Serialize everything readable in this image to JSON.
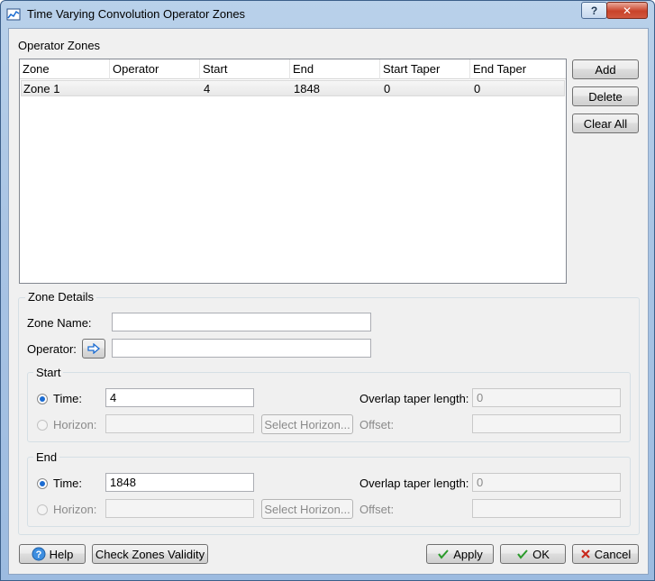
{
  "window": {
    "title": "Time Varying Convolution Operator Zones",
    "help_glyph": "?",
    "close_glyph": "✕"
  },
  "zones": {
    "label": "Operator Zones",
    "columns": [
      "Zone",
      "Operator",
      "Start",
      "End",
      "Start Taper",
      "End Taper"
    ],
    "rows": [
      {
        "zone": "Zone 1",
        "operator": "",
        "start": "4",
        "end": "1848",
        "start_taper": "0",
        "end_taper": "0"
      }
    ],
    "buttons": {
      "add": "Add",
      "delete": "Delete",
      "clear_all": "Clear All"
    }
  },
  "details": {
    "label": "Zone Details",
    "zone_name_label": "Zone Name:",
    "zone_name_value": "",
    "operator_label": "Operator:",
    "operator_value": ""
  },
  "start": {
    "label": "Start",
    "time_label": "Time:",
    "time_value": "4",
    "time_selected": true,
    "horizon_label": "Horizon:",
    "horizon_value": "",
    "select_horizon": "Select Horizon...",
    "overlap_label": "Overlap taper length:",
    "overlap_value": "0",
    "offset_label": "Offset:",
    "offset_value": ""
  },
  "end": {
    "label": "End",
    "time_label": "Time:",
    "time_value": "1848",
    "time_selected": true,
    "horizon_label": "Horizon:",
    "horizon_value": "",
    "select_horizon": "Select Horizon...",
    "overlap_label": "Overlap taper length:",
    "overlap_value": "0",
    "offset_label": "Offset:",
    "offset_value": ""
  },
  "footer": {
    "help": "Help",
    "check": "Check Zones Validity",
    "apply": "Apply",
    "ok": "OK",
    "cancel": "Cancel"
  },
  "colors": {
    "accent": "#1a6bd1",
    "ok_check": "#2a9a2a",
    "cancel_x": "#c8281c"
  }
}
